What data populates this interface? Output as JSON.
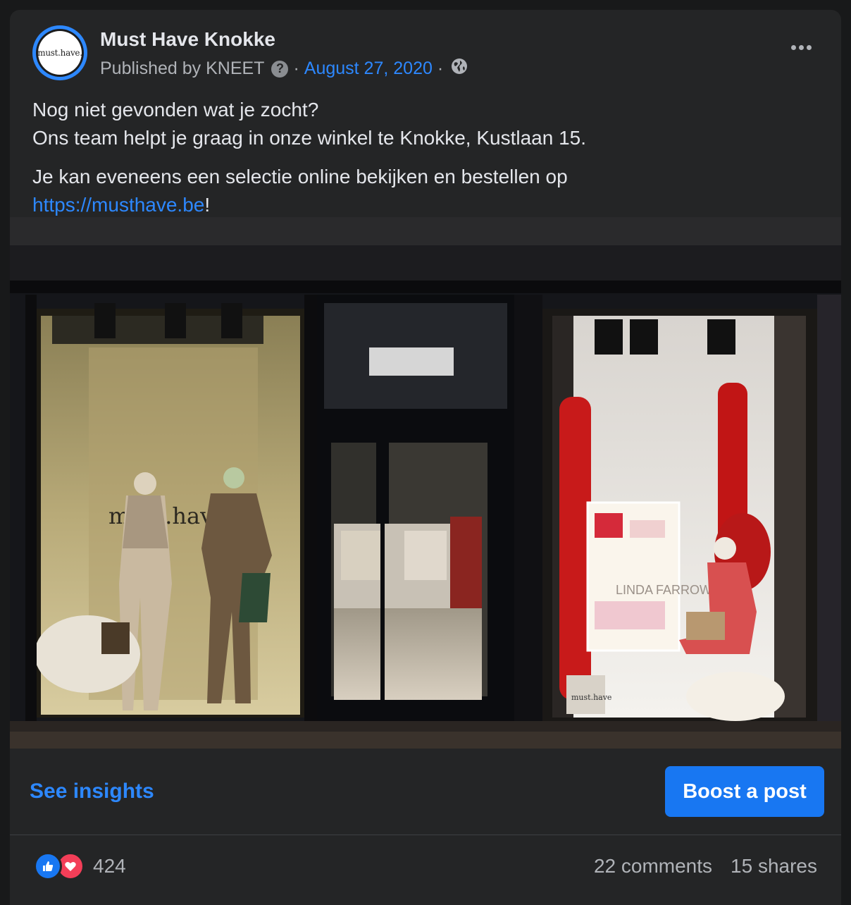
{
  "post": {
    "page_name": "Must Have Knokke",
    "avatar_text": "must.have.",
    "published_by": "Published by KNEET",
    "help_icon": "?",
    "separator": "·",
    "date": "August 27, 2020",
    "audience_icon": "globe-icon",
    "more_icon": "more-options-icon",
    "text_line_1": "Nog niet gevonden wat je zocht?",
    "text_line_2": "Ons team helpt je graag in onze winkel te Knokke, Kustlaan 15.",
    "text_line_3": "Je kan eveneens een selectie online bekijken en bestellen op",
    "link": "https://musthave.be",
    "link_suffix": "!"
  },
  "photo": {
    "window_logo_text": "must.have.",
    "brand_sign": "LINDA FARROW",
    "bag_label": "must.have"
  },
  "actions": {
    "insights_label": "See insights",
    "boost_label": "Boost a post"
  },
  "footer": {
    "reaction_count": "424",
    "comments": "22 comments",
    "shares": "15 shares"
  },
  "colors": {
    "accent": "#2d88ff",
    "boost_button": "#1877f2",
    "card": "#242526",
    "background": "#18191a",
    "like": "#1877f2",
    "love": "#f33e58"
  }
}
